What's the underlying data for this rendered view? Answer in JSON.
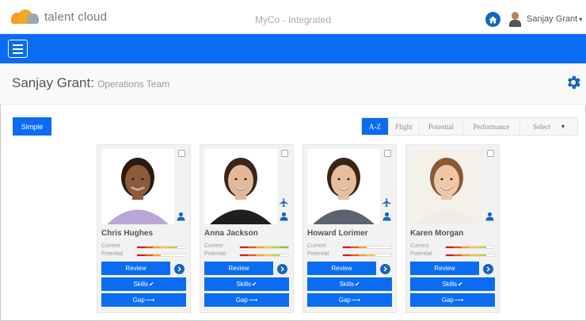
{
  "header": {
    "logo_text": "talent cloud",
    "app_title": "MyCo - Integrated",
    "user_name": "Sanjay Grant",
    "user_caret": "▾"
  },
  "page": {
    "title": "Sanjay Grant:",
    "subtitle": "Operations Team"
  },
  "controls": {
    "simple_label": "Simple",
    "sort_tabs": [
      {
        "label": "A-Z",
        "active": true
      },
      {
        "label": "Flight",
        "active": false
      },
      {
        "label": "Potential",
        "active": false
      },
      {
        "label": "Performance",
        "active": false
      },
      {
        "label": "Select",
        "active": false
      }
    ],
    "select_caret": "▾"
  },
  "labels": {
    "current": "Current",
    "potential": "Potential",
    "review": "Review",
    "skills": "Skills",
    "gap": "Gap",
    "skills_glyph": "✔",
    "gap_glyph": "⟿"
  },
  "employees": [
    {
      "name": "Chris Hughes",
      "flight_risk_icon": false,
      "skin": "#8d5a3b",
      "hair": "#2a1a12",
      "shirt": "#b9a6d6",
      "bg": "#ffffff",
      "current_fill": 0.78,
      "potential_fill": 0.55
    },
    {
      "name": "Anna Jackson",
      "flight_risk_icon": true,
      "skin": "#e2b89a",
      "hair": "#3b2418",
      "shirt": "#1f1f1f",
      "bg": "#ffffff",
      "current_fill": 0.98,
      "potential_fill": 0.78
    },
    {
      "name": "Howard Lorimer",
      "flight_risk_icon": true,
      "skin": "#e6bd9e",
      "hair": "#3a2417",
      "shirt": "#5a6470",
      "bg": "#ffffff",
      "current_fill": 0.55,
      "potential_fill": 0.62
    },
    {
      "name": "Karen Morgan",
      "flight_risk_icon": false,
      "skin": "#efc7a6",
      "hair": "#8a5a34",
      "shirt": "#f3ece2",
      "bg": "#f4f0ea",
      "current_fill": 0.78,
      "potential_fill": 0.8
    }
  ],
  "rating_colors": [
    "#d81b1b",
    "#e8541c",
    "#f5a623",
    "#f2c94c",
    "#b6d636",
    "#7cc242"
  ],
  "icons": {
    "logo": "cloud-logo-icon",
    "home": "home-icon",
    "user": "user-avatar-icon",
    "menu": "hamburger-menu-icon",
    "settings": "gear-icon",
    "checkbox": "checkbox-icon",
    "flight": "airplane-icon",
    "person": "person-icon",
    "go": "chevron-right-circle-icon"
  }
}
